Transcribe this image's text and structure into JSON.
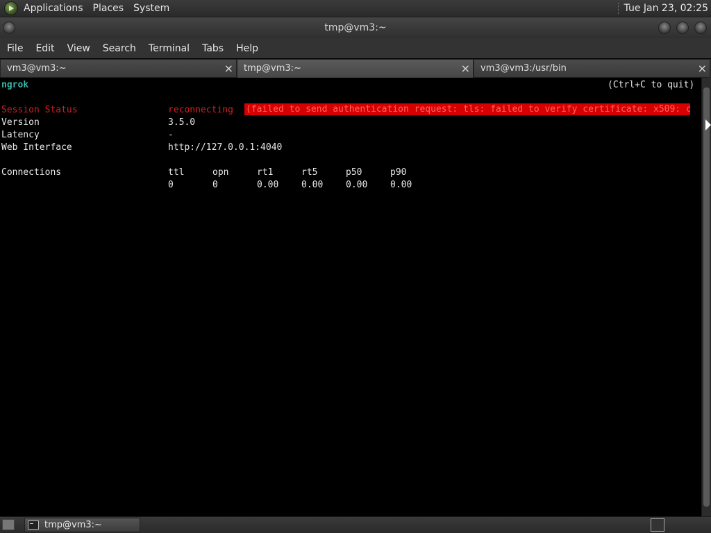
{
  "top_panel": {
    "menus": [
      "Applications",
      "Places",
      "System"
    ],
    "clock": "Tue Jan 23, 02:25"
  },
  "window": {
    "title": "tmp@vm3:~"
  },
  "menubar": {
    "items": [
      "File",
      "Edit",
      "View",
      "Search",
      "Terminal",
      "Tabs",
      "Help"
    ]
  },
  "tabs": [
    {
      "label": "vm3@vm3:~",
      "close": "×"
    },
    {
      "label": "tmp@vm3:~",
      "close": "×",
      "active": true
    },
    {
      "label": "vm3@vm3:/usr/bin",
      "close": "×"
    }
  ],
  "terminal": {
    "brand": "ngrok",
    "quit_hint": "(Ctrl+C to quit)",
    "session_status_label": "Session Status",
    "session_status_value": "reconnecting",
    "error_text": "(failed to send authentication request: tls: failed to verify certificate: x509: c",
    "version_label": "Version",
    "version_value": "3.5.0",
    "latency_label": "Latency",
    "latency_value": "-",
    "web_interface_label": "Web Interface",
    "web_interface_value": "http://127.0.0.1:4040",
    "connections_label": "Connections",
    "connections_headers": [
      "ttl",
      "opn",
      "rt1",
      "rt5",
      "p50",
      "p90"
    ],
    "connections_values": [
      "0",
      "0",
      "0.00",
      "0.00",
      "0.00",
      "0.00"
    ]
  },
  "taskbar": {
    "task_label": "tmp@vm3:~"
  },
  "colors": {
    "brand": "#35b7a7",
    "error_red": "#d42020",
    "error_highlight": "#d70000"
  }
}
